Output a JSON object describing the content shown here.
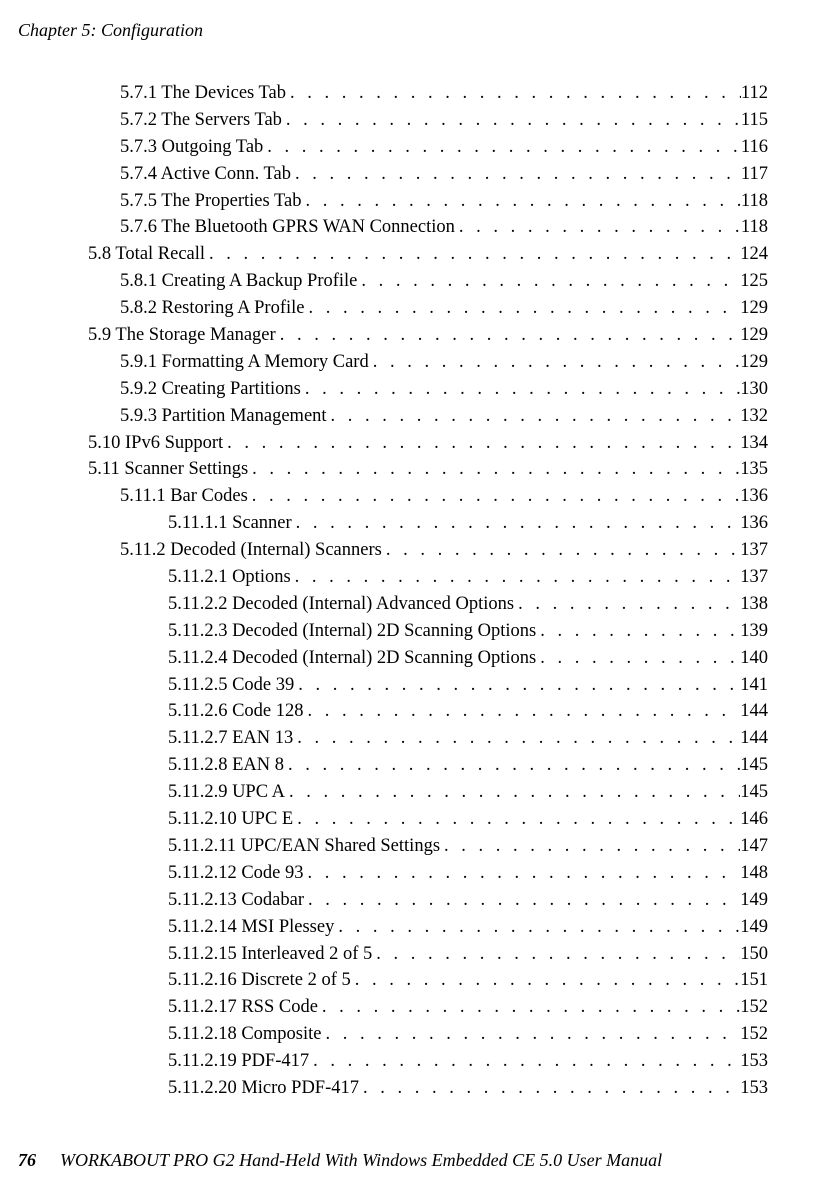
{
  "header": {
    "running_title": "Chapter 5: Configuration"
  },
  "footer": {
    "page_number": "76",
    "book_title": "WORKABOUT PRO G2 Hand-Held With Windows Embedded CE 5.0 User Manual"
  },
  "toc": [
    {
      "indent": 2,
      "label": "5.7.1  The Devices Tab",
      "page": "112"
    },
    {
      "indent": 2,
      "label": "5.7.2  The Servers Tab",
      "page": "115"
    },
    {
      "indent": 2,
      "label": "5.7.3  Outgoing Tab",
      "page": "116"
    },
    {
      "indent": 2,
      "label": "5.7.4  Active Conn. Tab",
      "page": "117"
    },
    {
      "indent": 2,
      "label": "5.7.5  The Properties Tab",
      "page": "118"
    },
    {
      "indent": 2,
      "label": "5.7.6  The Bluetooth GPRS WAN Connection",
      "page": "118"
    },
    {
      "indent": 1,
      "label": "5.8  Total Recall",
      "page": "124"
    },
    {
      "indent": 2,
      "label": "5.8.1  Creating A Backup Profile",
      "page": "125"
    },
    {
      "indent": 2,
      "label": "5.8.2  Restoring A Profile",
      "page": "129"
    },
    {
      "indent": 1,
      "label": "5.9  The Storage Manager",
      "page": "129"
    },
    {
      "indent": 2,
      "label": "5.9.1  Formatting A Memory Card",
      "page": "129"
    },
    {
      "indent": 2,
      "label": "5.9.2  Creating Partitions",
      "page": "130"
    },
    {
      "indent": 2,
      "label": "5.9.3  Partition Management",
      "page": "132"
    },
    {
      "indent": 1,
      "label": "5.10  IPv6 Support",
      "page": "134"
    },
    {
      "indent": 1,
      "label": "5.11  Scanner Settings",
      "page": "135"
    },
    {
      "indent": 2,
      "label": "5.11.1  Bar Codes",
      "page": "136"
    },
    {
      "indent": 3,
      "label": "5.11.1.1  Scanner",
      "page": "136"
    },
    {
      "indent": 2,
      "label": "5.11.2  Decoded (Internal) Scanners",
      "page": "137"
    },
    {
      "indent": 3,
      "label": "5.11.2.1  Options",
      "page": "137"
    },
    {
      "indent": 3,
      "label": "5.11.2.2  Decoded (Internal) Advanced Options",
      "page": "138"
    },
    {
      "indent": 3,
      "label": "5.11.2.3  Decoded (Internal) 2D Scanning Options",
      "page": "139"
    },
    {
      "indent": 3,
      "label": "5.11.2.4  Decoded (Internal) 2D Scanning Options",
      "page": "140"
    },
    {
      "indent": 3,
      "label": "5.11.2.5  Code 39",
      "page": "141"
    },
    {
      "indent": 3,
      "label": "5.11.2.6  Code 128",
      "page": "144"
    },
    {
      "indent": 3,
      "label": "5.11.2.7  EAN 13",
      "page": "144"
    },
    {
      "indent": 3,
      "label": "5.11.2.8  EAN 8",
      "page": "145"
    },
    {
      "indent": 3,
      "label": "5.11.2.9  UPC A",
      "page": "145"
    },
    {
      "indent": 3,
      "label": "5.11.2.10  UPC E",
      "page": "146"
    },
    {
      "indent": 3,
      "label": "5.11.2.11  UPC/EAN Shared Settings",
      "page": "147"
    },
    {
      "indent": 3,
      "label": "5.11.2.12  Code 93",
      "page": "148"
    },
    {
      "indent": 3,
      "label": "5.11.2.13  Codabar",
      "page": "149"
    },
    {
      "indent": 3,
      "label": "5.11.2.14  MSI Plessey",
      "page": "149"
    },
    {
      "indent": 3,
      "label": "5.11.2.15  Interleaved 2 of 5",
      "page": "150"
    },
    {
      "indent": 3,
      "label": "5.11.2.16  Discrete 2 of 5",
      "page": "151"
    },
    {
      "indent": 3,
      "label": "5.11.2.17  RSS Code",
      "page": "152"
    },
    {
      "indent": 3,
      "label": "5.11.2.18  Composite",
      "page": "152"
    },
    {
      "indent": 3,
      "label": "5.11.2.19  PDF-417",
      "page": "153"
    },
    {
      "indent": 3,
      "label": "5.11.2.20  Micro PDF-417",
      "page": "153"
    }
  ]
}
